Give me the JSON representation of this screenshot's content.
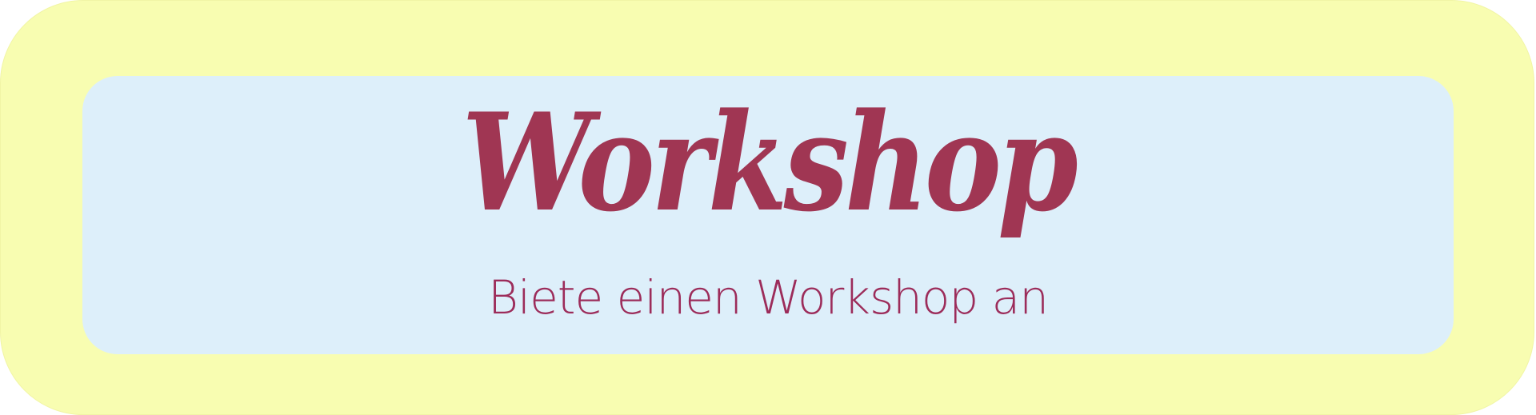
{
  "banner": {
    "title": "Workshop",
    "subtitle": "Biete einen Workshop an",
    "colors": {
      "outer_background": "#f8fdb1",
      "inner_background": "#ddeffa",
      "title_color": "#a03653",
      "subtitle_color": "#9c2c5a"
    }
  }
}
